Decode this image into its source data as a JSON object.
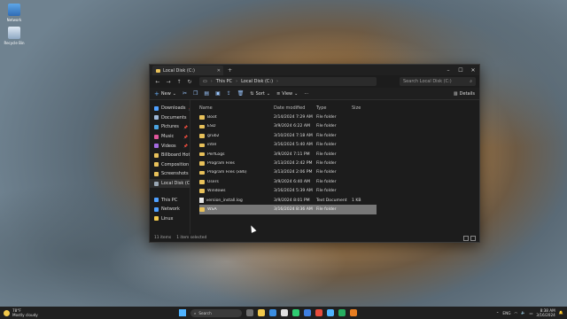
{
  "desktop": {
    "icons": [
      {
        "label": "Network",
        "icon": "network-icon"
      },
      {
        "label": "Recycle Bin",
        "icon": "recycle-bin-icon"
      }
    ]
  },
  "window": {
    "tab_title": "Local Disk (C:)",
    "controls": [
      "minimize",
      "maximize",
      "close"
    ],
    "breadcrumb": [
      "This PC",
      "Local Disk (C:)"
    ],
    "search_placeholder": "Search Local Disk (C:)",
    "toolbar": {
      "new_label": "New",
      "sort_label": "Sort",
      "view_label": "View",
      "more_label": "···",
      "details_label": "Details"
    },
    "nav": {
      "quick": [
        {
          "label": "Downloads",
          "color": "#4fa0ff",
          "pinned": true
        },
        {
          "label": "Documents",
          "color": "#9fb8d8",
          "pinned": true
        },
        {
          "label": "Pictures",
          "color": "#4aa3e0",
          "pinned": true
        },
        {
          "label": "Music",
          "color": "#e0569b",
          "pinned": true
        },
        {
          "label": "Videos",
          "color": "#a56be0",
          "pinned": true
        },
        {
          "label": "Billboard Hot",
          "color": "#e8c15a",
          "pinned": false
        },
        {
          "label": "Composition",
          "color": "#e8c15a",
          "pinned": false
        },
        {
          "label": "Screenshots",
          "color": "#e8c15a",
          "pinned": false
        },
        {
          "label": "Local Disk (C:)",
          "color": "#9aa7b4",
          "pinned": false
        }
      ],
      "system": [
        {
          "label": "This PC",
          "color": "#4fa0ff"
        },
        {
          "label": "Network",
          "color": "#4fa0ff"
        },
        {
          "label": "Linux",
          "color": "#f2c94c"
        }
      ]
    },
    "columns": {
      "name": "Name",
      "date": "Date modified",
      "type": "Type",
      "size": "Size"
    },
    "files": [
      {
        "name": "Boot",
        "date": "2/14/2024 7:29 AM",
        "type": "File folder",
        "size": "",
        "kind": "folder"
      },
      {
        "name": "ESD",
        "date": "3/9/2024 6:22 AM",
        "type": "File folder",
        "size": "",
        "kind": "folder"
      },
      {
        "name": "grub2",
        "date": "3/10/2024 7:18 AM",
        "type": "File folder",
        "size": "",
        "kind": "folder"
      },
      {
        "name": "intel",
        "date": "3/16/2024 5:40 AM",
        "type": "File folder",
        "size": "",
        "kind": "folder"
      },
      {
        "name": "PerfLogs",
        "date": "3/9/2024 7:11 PM",
        "type": "File folder",
        "size": "",
        "kind": "folder"
      },
      {
        "name": "Program Files",
        "date": "3/13/2024 2:42 PM",
        "type": "File folder",
        "size": "",
        "kind": "folder"
      },
      {
        "name": "Program Files (x86)",
        "date": "3/13/2024 2:06 PM",
        "type": "File folder",
        "size": "",
        "kind": "folder"
      },
      {
        "name": "Users",
        "date": "3/9/2024 6:40 AM",
        "type": "File folder",
        "size": "",
        "kind": "folder"
      },
      {
        "name": "Windows",
        "date": "3/16/2024 5:39 AM",
        "type": "File folder",
        "size": "",
        "kind": "folder"
      },
      {
        "name": "version_install.log",
        "date": "3/9/2024 8:01 PM",
        "type": "Text Document",
        "size": "1 KB",
        "kind": "doc"
      },
      {
        "name": "WSA",
        "date": "3/16/2024 8:36 AM",
        "type": "File folder",
        "size": "",
        "kind": "folder",
        "selected": true
      }
    ],
    "status": {
      "count": "11 items",
      "selected": "1 item selected"
    }
  },
  "taskbar": {
    "weather_temp": "78°F",
    "weather_desc": "Mostly cloudy",
    "search_label": "Search",
    "apps": [
      "#6e6e6e",
      "#f2c94c",
      "#3a8de0",
      "#e0e0e0",
      "#2ecc71",
      "#3f7fe0",
      "#e74c3c",
      "#4fb3ff",
      "#27ae60",
      "#e67e22"
    ],
    "lang": "ENG",
    "time": "8:38 AM",
    "date": "3/16/2024"
  }
}
